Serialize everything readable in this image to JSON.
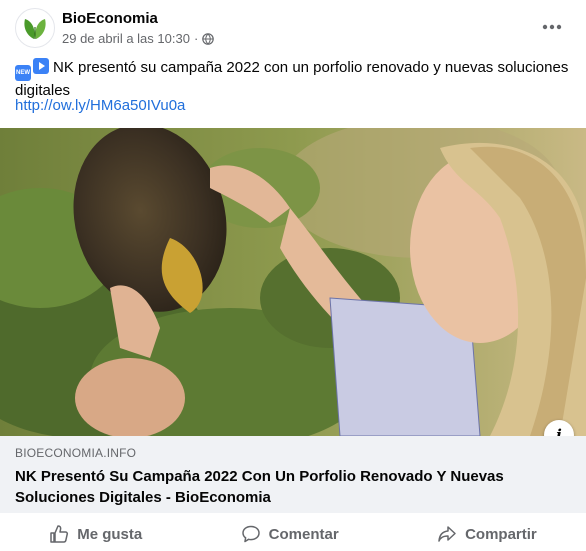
{
  "post": {
    "page_name": "BioEconomia",
    "timestamp": "29 de abril a las 10:30",
    "separator": "·",
    "privacy_icon": "globe-icon",
    "more_icon": "ellipsis-icon",
    "text": "NK presentó su campaña 2022 con un porfolio renovado y nuevas soluciones digitales",
    "emojis": [
      "new-icon",
      "play-icon"
    ],
    "link": "http://ow.ly/HM6a50IVu0a"
  },
  "link_preview": {
    "domain": "BIOECONOMIA.INFO",
    "headline": "NK Presentó Su Campaña 2022 Con Un Porfolio Renovado Y Nuevas Soluciones Digitales - BioEconomia",
    "info_icon": "info-icon",
    "info_glyph": "i"
  },
  "actions": {
    "like_label": "Me gusta",
    "comment_label": "Comentar",
    "share_label": "Compartir"
  },
  "colors": {
    "link": "#216fdb",
    "secondary_text": "#65676b",
    "preview_bg": "#f0f2f5",
    "logo_green": "#5aa02c"
  }
}
